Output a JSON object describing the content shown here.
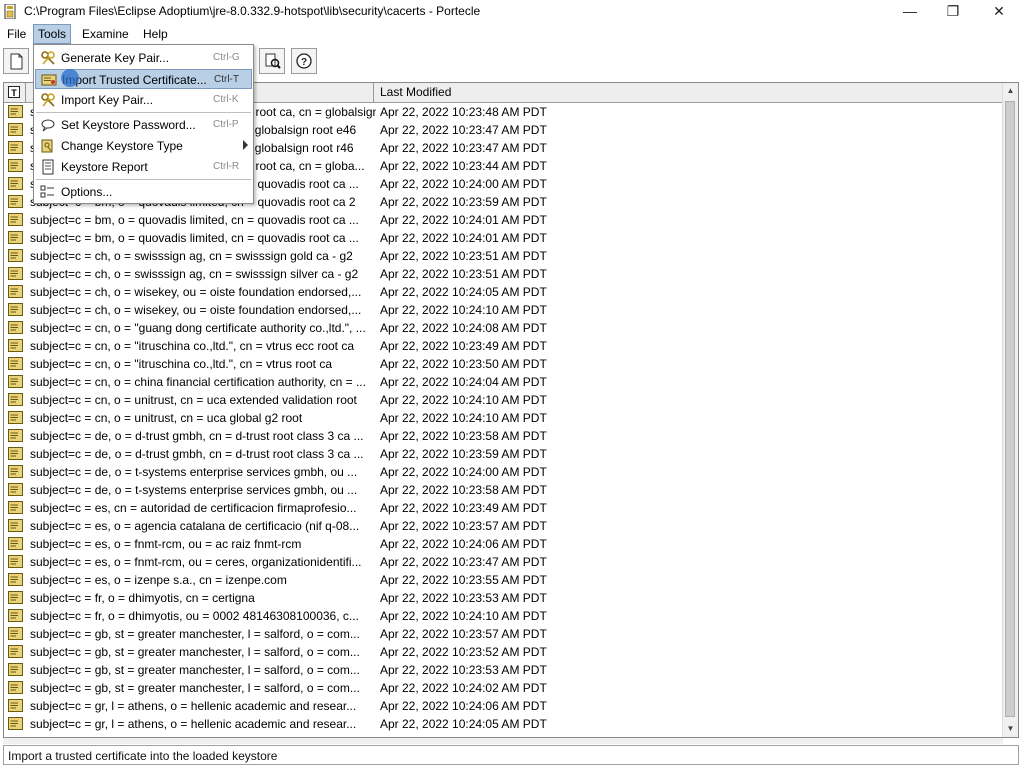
{
  "window": {
    "title": "C:\\Program Files\\Eclipse Adoptium\\jre-8.0.332.9-hotspot\\lib\\security\\cacerts - Portecle",
    "minimize": "—",
    "maximize": "❐",
    "close": "✕"
  },
  "menubar": [
    {
      "label": "File"
    },
    {
      "label": "Tools"
    },
    {
      "label": "Examine"
    },
    {
      "label": "Help"
    }
  ],
  "tools_menu": {
    "items": [
      {
        "label": "Generate Key Pair...",
        "shortcut": "Ctrl-G"
      },
      {
        "label": "Import Trusted Certificate...",
        "shortcut": "Ctrl-T"
      },
      {
        "label": "Import Key Pair...",
        "shortcut": "Ctrl-K"
      },
      {
        "label": "Set Keystore Password...",
        "shortcut": "Ctrl-P"
      },
      {
        "label": "Change Keystore Type",
        "shortcut": ""
      },
      {
        "label": "Keystore Report",
        "shortcut": "Ctrl-R"
      },
      {
        "label": "Options...",
        "shortcut": ""
      }
    ]
  },
  "table": {
    "columns": [
      "",
      "Last Modified"
    ],
    "rows": [
      {
        "alias": "subject=c = be, o = globalsign nv-sa, ou = root ca, cn = globalsign gmbh, cn = glob...",
        "modified": "Apr 22, 2022 10:23:48 AM PDT"
      },
      {
        "alias": "subject=c = be, o = globalsign nv-sa, cn = globalsign root e46",
        "modified": "Apr 22, 2022 10:23:47 AM PDT"
      },
      {
        "alias": "subject=c = be, o = globalsign nv-sa, cn = globalsign root r46",
        "modified": "Apr 22, 2022 10:23:47 AM PDT"
      },
      {
        "alias": "subject=c = be, o = globalsign nv-sa, ou = root ca, cn = globa...",
        "modified": "Apr 22, 2022 10:23:44 AM PDT"
      },
      {
        "alias": "subject=c = bm, o = quovadis limited, cn = quovadis root ca ...",
        "modified": "Apr 22, 2022 10:24:00 AM PDT"
      },
      {
        "alias": "subject=c = bm, o = quovadis limited, cn = quovadis root ca 2",
        "modified": "Apr 22, 2022 10:23:59 AM PDT"
      },
      {
        "alias": "subject=c = bm, o = quovadis limited, cn = quovadis root ca ...",
        "modified": "Apr 22, 2022 10:24:01 AM PDT"
      },
      {
        "alias": "subject=c = bm, o = quovadis limited, cn = quovadis root ca ...",
        "modified": "Apr 22, 2022 10:24:01 AM PDT"
      },
      {
        "alias": "subject=c = ch, o = swisssign ag, cn = swisssign gold ca - g2",
        "modified": "Apr 22, 2022 10:23:51 AM PDT"
      },
      {
        "alias": "subject=c = ch, o = swisssign ag, cn = swisssign silver ca - g2",
        "modified": "Apr 22, 2022 10:23:51 AM PDT"
      },
      {
        "alias": "subject=c = ch, o = wisekey, ou = oiste foundation endorsed,...",
        "modified": "Apr 22, 2022 10:24:05 AM PDT"
      },
      {
        "alias": "subject=c = ch, o = wisekey, ou = oiste foundation endorsed,...",
        "modified": "Apr 22, 2022 10:24:10 AM PDT"
      },
      {
        "alias": "subject=c = cn, o = \"guang dong certificate authority co.,ltd.\", ...",
        "modified": "Apr 22, 2022 10:24:08 AM PDT"
      },
      {
        "alias": "subject=c = cn, o = \"itruschina co.,ltd.\", cn = vtrus ecc root ca",
        "modified": "Apr 22, 2022 10:23:49 AM PDT"
      },
      {
        "alias": "subject=c = cn, o = \"itruschina co.,ltd.\", cn = vtrus root ca",
        "modified": "Apr 22, 2022 10:23:50 AM PDT"
      },
      {
        "alias": "subject=c = cn, o = china financial certification authority, cn = ...",
        "modified": "Apr 22, 2022 10:24:04 AM PDT"
      },
      {
        "alias": "subject=c = cn, o = unitrust, cn = uca extended validation root",
        "modified": "Apr 22, 2022 10:24:10 AM PDT"
      },
      {
        "alias": "subject=c = cn, o = unitrust, cn = uca global g2 root",
        "modified": "Apr 22, 2022 10:24:10 AM PDT"
      },
      {
        "alias": "subject=c = de, o = d-trust gmbh, cn = d-trust root class 3 ca ...",
        "modified": "Apr 22, 2022 10:23:58 AM PDT"
      },
      {
        "alias": "subject=c = de, o = d-trust gmbh, cn = d-trust root class 3 ca ...",
        "modified": "Apr 22, 2022 10:23:59 AM PDT"
      },
      {
        "alias": "subject=c = de, o = t-systems enterprise services gmbh, ou ...",
        "modified": "Apr 22, 2022 10:24:00 AM PDT"
      },
      {
        "alias": "subject=c = de, o = t-systems enterprise services gmbh, ou ...",
        "modified": "Apr 22, 2022 10:23:58 AM PDT"
      },
      {
        "alias": "subject=c = es, cn = autoridad de certificacion firmaprofesio...",
        "modified": "Apr 22, 2022 10:23:49 AM PDT"
      },
      {
        "alias": "subject=c = es, o = agencia catalana de certificacio (nif q-08...",
        "modified": "Apr 22, 2022 10:23:57 AM PDT"
      },
      {
        "alias": "subject=c = es, o = fnmt-rcm, ou = ac raiz fnmt-rcm",
        "modified": "Apr 22, 2022 10:24:06 AM PDT"
      },
      {
        "alias": "subject=c = es, o = fnmt-rcm, ou = ceres, organizationidentifi...",
        "modified": "Apr 22, 2022 10:23:47 AM PDT"
      },
      {
        "alias": "subject=c = es, o = izenpe s.a., cn = izenpe.com",
        "modified": "Apr 22, 2022 10:23:55 AM PDT"
      },
      {
        "alias": "subject=c = fr, o = dhimyotis, cn = certigna",
        "modified": "Apr 22, 2022 10:23:53 AM PDT"
      },
      {
        "alias": "subject=c = fr, o = dhimyotis, ou = 0002 48146308100036, c...",
        "modified": "Apr 22, 2022 10:24:10 AM PDT"
      },
      {
        "alias": "subject=c = gb, st = greater manchester, l = salford, o = com...",
        "modified": "Apr 22, 2022 10:23:57 AM PDT"
      },
      {
        "alias": "subject=c = gb, st = greater manchester, l = salford, o = com...",
        "modified": "Apr 22, 2022 10:23:52 AM PDT"
      },
      {
        "alias": "subject=c = gb, st = greater manchester, l = salford, o = com...",
        "modified": "Apr 22, 2022 10:23:53 AM PDT"
      },
      {
        "alias": "subject=c = gb, st = greater manchester, l = salford, o = com...",
        "modified": "Apr 22, 2022 10:24:02 AM PDT"
      },
      {
        "alias": "subject=c = gr, l = athens, o = hellenic academic and resear...",
        "modified": "Apr 22, 2022 10:24:06 AM PDT"
      },
      {
        "alias": "subject=c = gr, l = athens, o = hellenic academic and resear...",
        "modified": "Apr 22, 2022 10:24:05 AM PDT"
      }
    ]
  },
  "status": {
    "text": "Import a trusted certificate into the loaded keystore"
  },
  "colors": {
    "highlight": "#b8cfe5",
    "highlight_border": "#7a9bbd",
    "cert_icon": "#d8c44a"
  },
  "icons": {
    "app": "portecle-app-icon",
    "toolbar": [
      "new-keystore-icon",
      "examine-certificate-icon",
      "help-icon"
    ],
    "row": "trusted-certificate-icon",
    "header": "type-column-icon"
  }
}
